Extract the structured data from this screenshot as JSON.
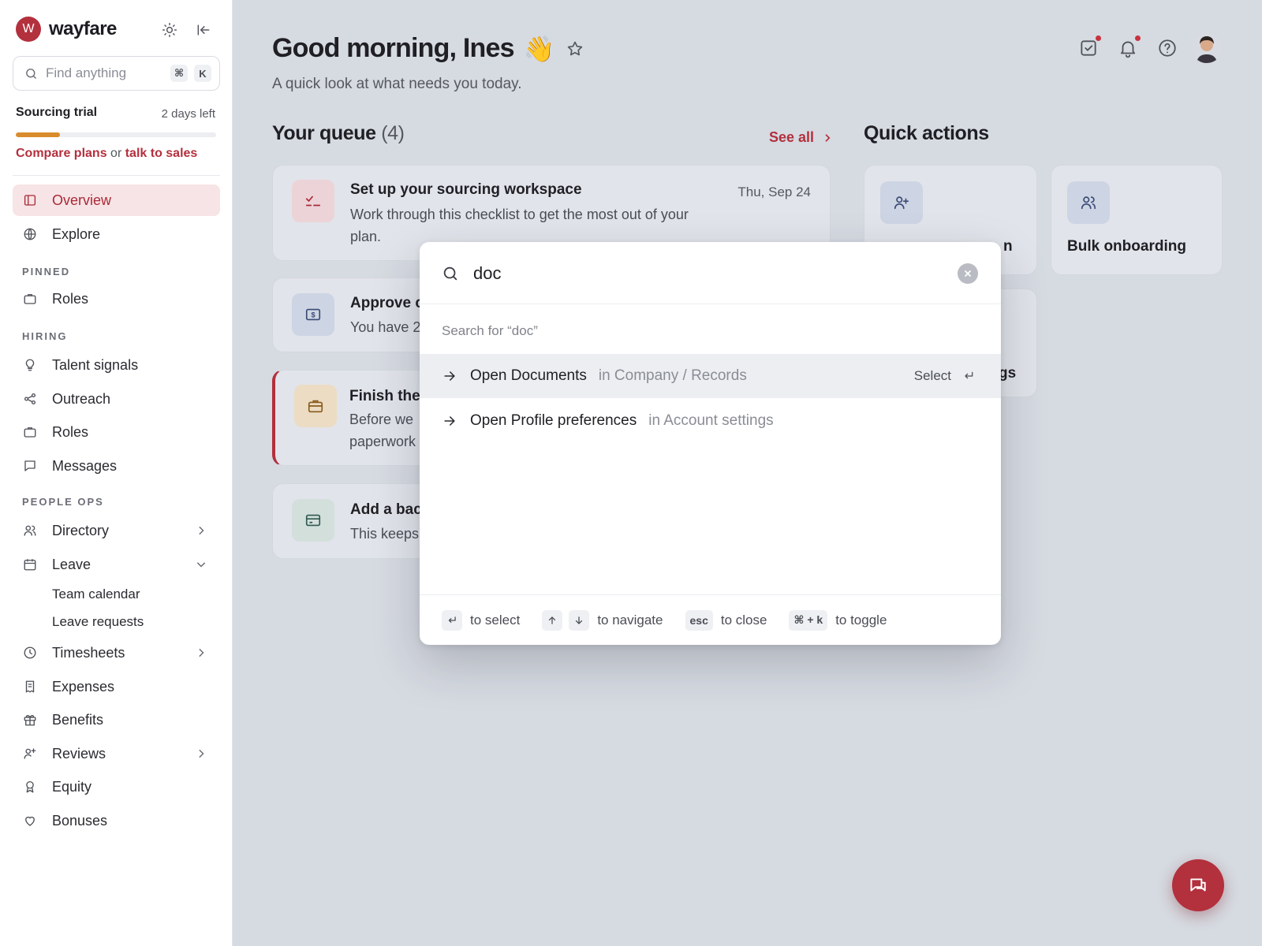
{
  "brand": {
    "logo_letter": "W",
    "name": "wayfare"
  },
  "sidebar": {
    "search_placeholder": "Find anything",
    "search_keys": [
      "⌘",
      "K"
    ],
    "trial": {
      "title": "Sourcing trial",
      "days_left": "2 days left",
      "progress": 0.22,
      "link1": "Compare plans",
      "or": " or ",
      "link2": "talk to sales"
    },
    "top_items": [
      {
        "label": "Overview",
        "icon": "layout-icon"
      },
      {
        "label": "Explore",
        "icon": "globe-icon"
      }
    ],
    "sections": {
      "pinned": "PINNED",
      "hiring": "HIRING",
      "people_ops": "PEOPLE OPS"
    },
    "pinned": [
      {
        "label": "Roles",
        "icon": "briefcase-icon"
      }
    ],
    "hiring": [
      {
        "label": "Talent signals",
        "icon": "lightbulb-icon"
      },
      {
        "label": "Outreach",
        "icon": "share-icon"
      },
      {
        "label": "Roles",
        "icon": "briefcase-icon"
      },
      {
        "label": "Messages",
        "icon": "chat-icon"
      }
    ],
    "people_ops": [
      {
        "label": "Directory",
        "icon": "users-icon"
      },
      {
        "label": "Leave",
        "icon": "calendar-icon"
      },
      {
        "label": "Timesheets",
        "icon": "clock-icon"
      },
      {
        "label": "Expenses",
        "icon": "receipt-icon"
      },
      {
        "label": "Benefits",
        "icon": "gift-icon"
      },
      {
        "label": "Reviews",
        "icon": "user-star-icon"
      },
      {
        "label": "Equity",
        "icon": "award-icon"
      },
      {
        "label": "Bonuses",
        "icon": "heart-icon"
      }
    ],
    "leave_sub": [
      "Team calendar",
      "Leave requests"
    ]
  },
  "header": {
    "greeting": "Good morning, Ines",
    "wave": "👋",
    "subtitle": "A quick look at what needs you today."
  },
  "queue": {
    "title": "Your queue",
    "count": "(4)",
    "see_all": "See all",
    "items": [
      {
        "title": "Set up your sourcing workspace",
        "desc": "Work through this checklist to get the most out of your plan.",
        "date": "Thu, Sep 24"
      },
      {
        "title": "Approve c",
        "desc": "You have 2"
      },
      {
        "title": "Finish the",
        "desc": "Before we",
        "desc2": "paperwork"
      },
      {
        "title": "Add a bac",
        "desc": "This keeps"
      }
    ]
  },
  "quick_actions": {
    "title": "Quick actions",
    "items": [
      {
        "label": "n"
      },
      {
        "label": "Bulk onboarding"
      },
      {
        "label": "gs"
      }
    ]
  },
  "palette": {
    "query": "doc",
    "hint": "Search for “doc”",
    "results": [
      {
        "name": "Open Documents",
        "location": "in Company / Records",
        "select_label": "Select"
      },
      {
        "name": "Open Profile preferences",
        "location": "in Account settings"
      }
    ],
    "footer": {
      "select": "to select",
      "navigate": "to navigate",
      "esc_key": "esc",
      "close": "to close",
      "toggle_key": "⌘ + k",
      "toggle": "to toggle"
    }
  },
  "colors": {
    "accent": "#b3303d",
    "trial_bar": "#d98c2b",
    "active_bg": "#f7e4e6"
  }
}
